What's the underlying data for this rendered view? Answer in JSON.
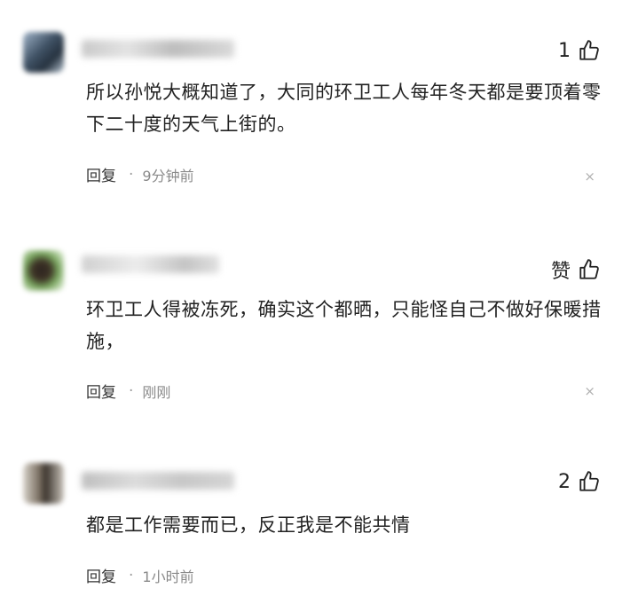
{
  "comments": [
    {
      "like_label": "1",
      "text": "所以孙悦大概知道了，大同的环卫工人每年冬天都是要顶着零下二十度的天气上街的。",
      "reply_label": "回复",
      "separator": "·",
      "time": "9分钟前",
      "close_glyph": "×"
    },
    {
      "like_label": "赞",
      "text": "环卫工人得被冻死，确实这个都晒，只能怪自己不做好保暖措施，",
      "reply_label": "回复",
      "separator": "·",
      "time": "刚刚",
      "close_glyph": "×"
    },
    {
      "like_label": "2",
      "text": "都是工作需要而已，反正我是不能共情",
      "reply_label": "回复",
      "separator": "·",
      "time": "1小时前",
      "close_glyph": ""
    }
  ],
  "icons": {
    "like": "thumbs-up-icon",
    "close": "close-icon"
  }
}
